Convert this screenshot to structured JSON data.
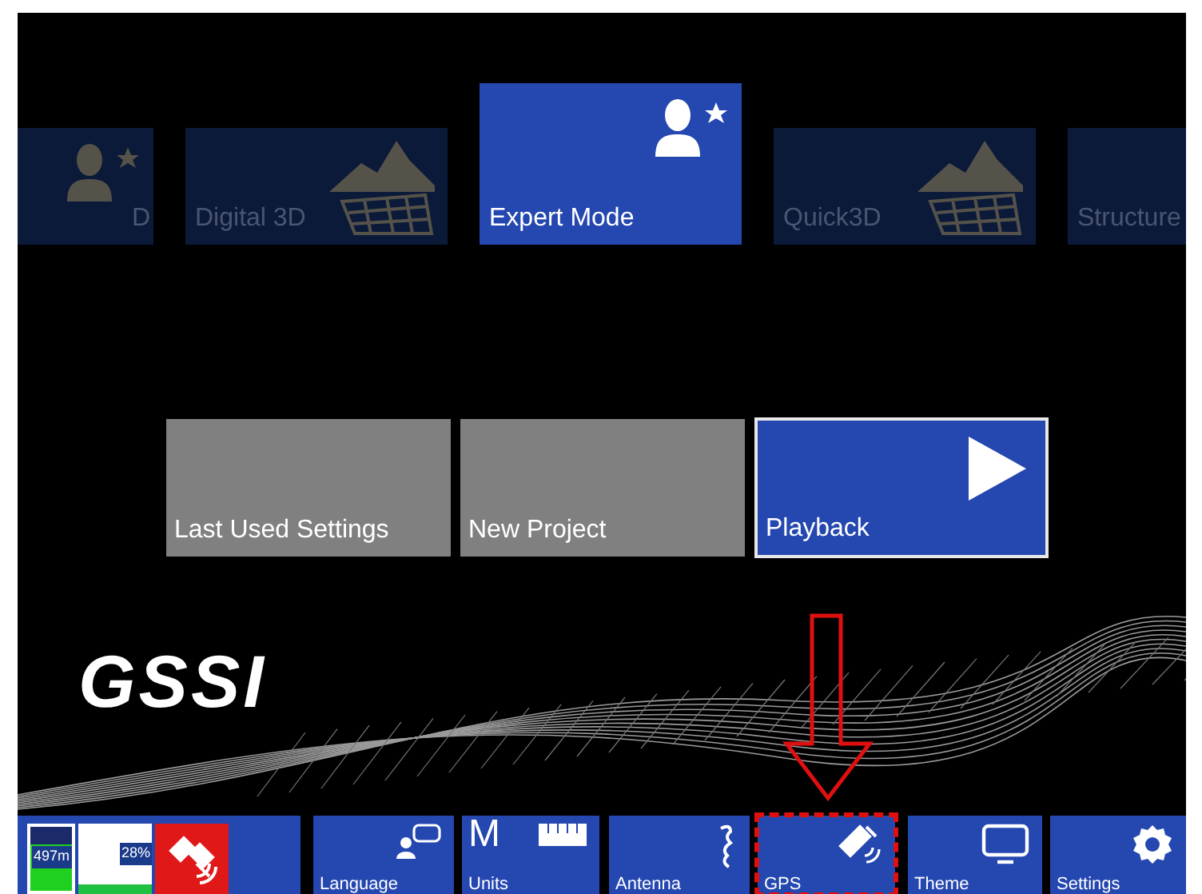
{
  "carousel": [
    {
      "label": "D",
      "kind": "person",
      "selected": false
    },
    {
      "label": "Digital 3D",
      "kind": "terrain",
      "selected": false
    },
    {
      "label": "Expert Mode",
      "kind": "person",
      "selected": true
    },
    {
      "label": "Quick3D",
      "kind": "terrain",
      "selected": false
    },
    {
      "label": "Structure",
      "selected": false
    }
  ],
  "actions": [
    {
      "label": "Last Used Settings",
      "kind": "plain",
      "selected": false
    },
    {
      "label": "New Project",
      "kind": "plain",
      "selected": false
    },
    {
      "label": "Playback",
      "kind": "play",
      "selected": true
    }
  ],
  "logo": "GSSI",
  "status": {
    "battery": "497m",
    "level": 0.75,
    "storage": "28%",
    "connected": false
  },
  "toolbar": [
    {
      "label": "Language",
      "kind": "language",
      "highlighted": false
    },
    {
      "symbol": "M",
      "label": "Units",
      "kind": "units",
      "highlighted": false
    },
    {
      "label": "Antenna",
      "kind": "antenna",
      "highlighted": false
    },
    {
      "label": "GPS",
      "kind": "satellite",
      "highlighted": true
    },
    {
      "label": "Theme",
      "kind": "monitor",
      "highlighted": false
    },
    {
      "label": "Settings",
      "kind": "gear",
      "highlighted": false
    }
  ]
}
